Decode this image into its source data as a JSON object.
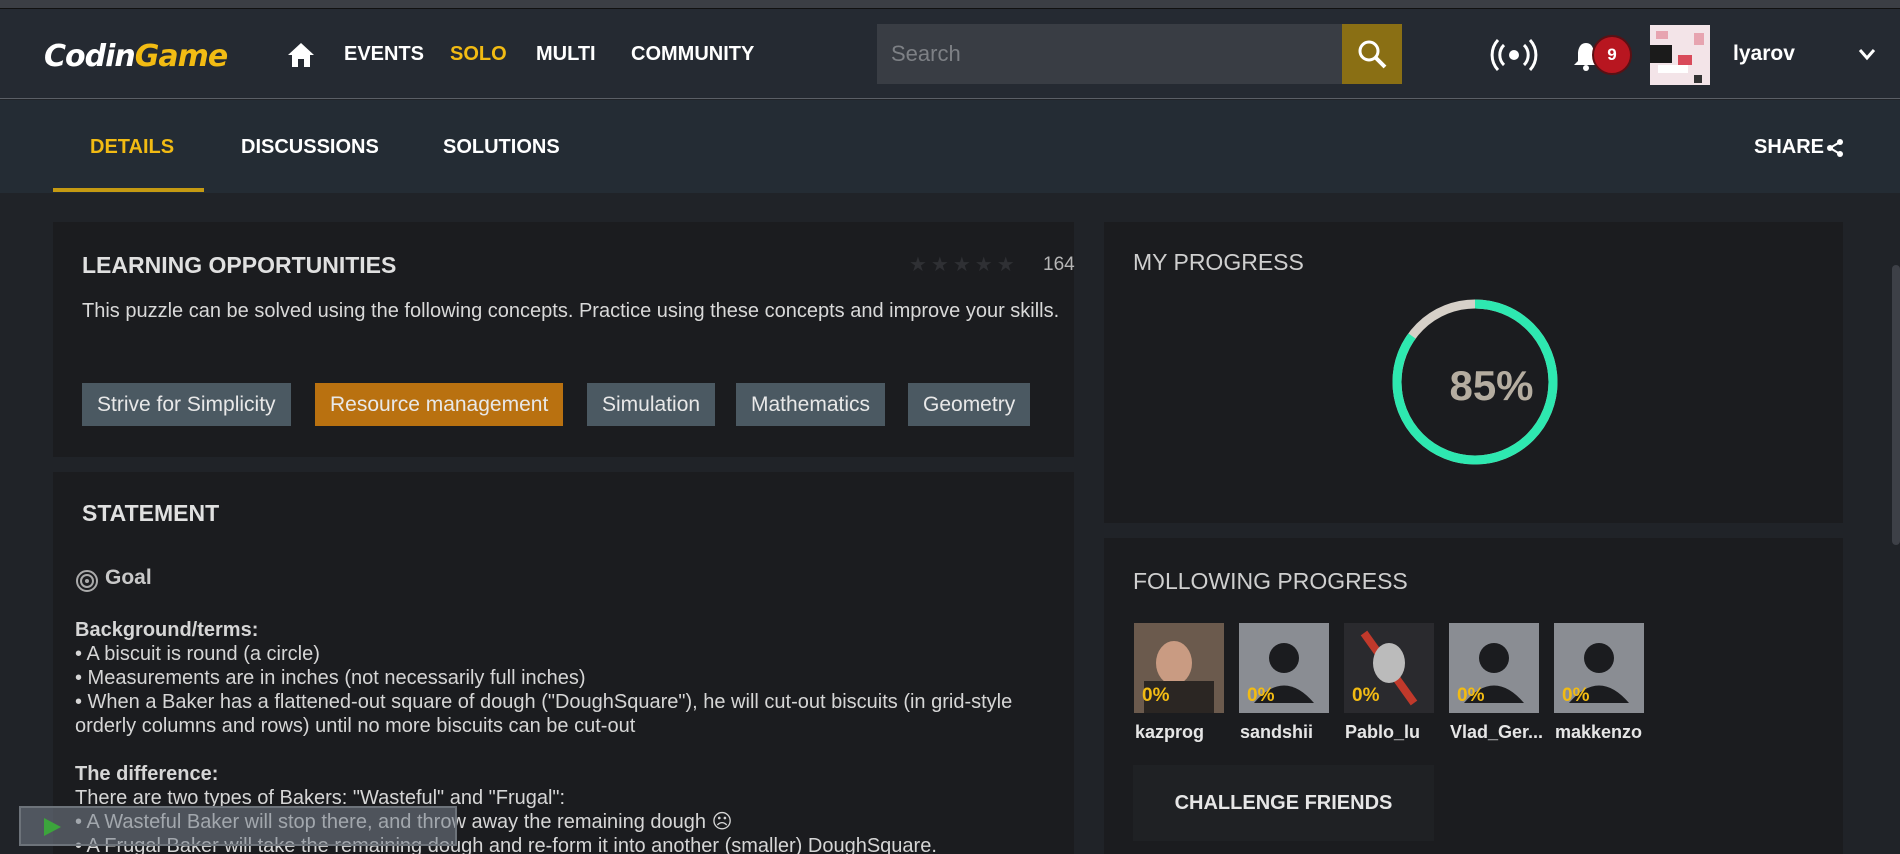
{
  "nav": {
    "logo": "CodinGame",
    "links": [
      "EVENTS",
      "SOLO",
      "MULTI",
      "COMMUNITY"
    ],
    "search_placeholder": "Search",
    "notification_count": "9",
    "username": "lyarov",
    "accent_color": "#f2bb13"
  },
  "tabs": {
    "items": [
      "DETAILS",
      "DISCUSSIONS",
      "SOLUTIONS"
    ],
    "share": "SHARE"
  },
  "learning": {
    "title": "LEARNING OPPORTUNITIES",
    "rating_count": "164",
    "description": "This puzzle can be solved using the following concepts. Practice using these concepts and improve your skills.",
    "tags": [
      "Strive for Simplicity",
      "Resource management",
      "Simulation",
      "Mathematics",
      "Geometry"
    ]
  },
  "statement": {
    "title": "STATEMENT",
    "goal": "Goal",
    "background_heading": "Background/terms:",
    "background_items": [
      "• A biscuit is round (a circle)",
      "• Measurements are in inches (not necessarily full inches)",
      "• When a Baker has a flattened-out square of dough (\"DoughSquare\"), he will cut-out biscuits (in grid-style orderly columns and rows) until no more biscuits can be cut-out"
    ],
    "difference_heading": "The difference:",
    "difference_items": [
      "There are two types of Bakers: \"Wasteful\" and \"Frugal\":",
      "• A Wasteful Baker will stop there, and throw away the remaining dough ☹",
      "• A Frugal Baker will take the remaining dough and re-form it into another (smaller) DoughSquare."
    ]
  },
  "progress": {
    "title": "MY PROGRESS",
    "percent_label": "85%",
    "percent_value": 85,
    "ring_color": "#2ee8b0"
  },
  "following": {
    "title": "FOLLOWING PROGRESS",
    "friends": [
      {
        "name": "kazprog",
        "pct": "0%"
      },
      {
        "name": "sandshii",
        "pct": "0%"
      },
      {
        "name": "Pablo_lu",
        "pct": "0%"
      },
      {
        "name": "Vlad_Ger...",
        "pct": "0%"
      },
      {
        "name": "makkenzo",
        "pct": "0%"
      }
    ],
    "challenge_label": "CHALLENGE FRIENDS"
  }
}
